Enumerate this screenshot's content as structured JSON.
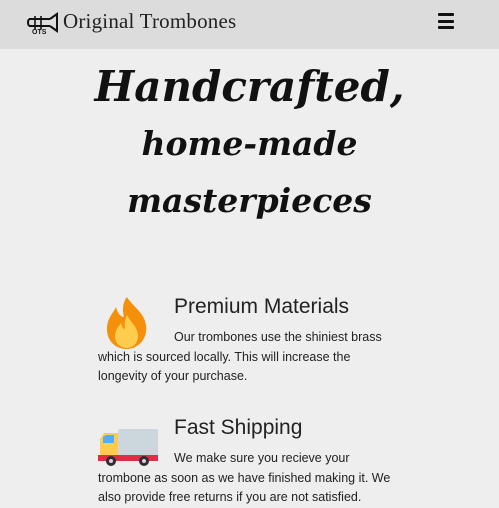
{
  "navbar": {
    "brand": "Original Trombones",
    "logo_icon": "trombone-logo-icon",
    "menu_icon": "hamburger-menu-icon"
  },
  "hero": {
    "line1": "Handcrafted,",
    "line2": "home-made",
    "line3": "masterpieces"
  },
  "features": [
    {
      "icon": "fire-icon",
      "title": "Premium Materials",
      "text": "Our trombones use the shiniest brass which is sourced locally. This will increase the longevity of your purchase."
    },
    {
      "icon": "delivery-truck-icon",
      "title": "Fast Shipping",
      "text": "We make sure you recieve your trombone as soon as we have finished making it. We also provide free returns if you are not satisfied."
    }
  ],
  "colors": {
    "navbar_bg": "#dcdcdc",
    "page_bg": "#eeeeee"
  }
}
